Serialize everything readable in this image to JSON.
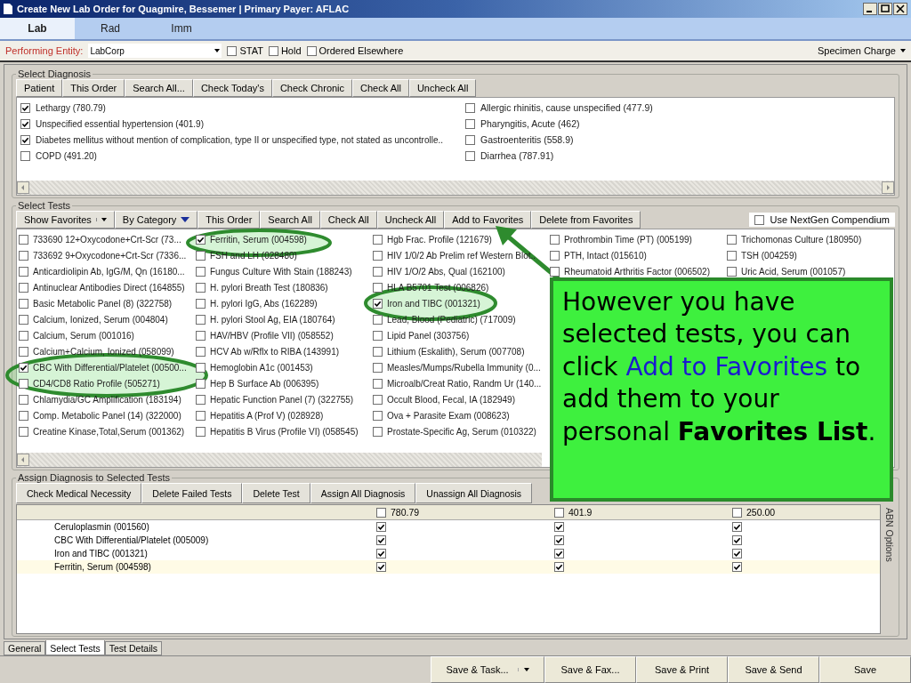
{
  "window": {
    "title": "Create New Lab Order for Quagmire, Bessemer | Primary Payer: AFLAC"
  },
  "tabs": [
    {
      "label": "Lab",
      "selected": true
    },
    {
      "label": "Rad",
      "selected": false
    },
    {
      "label": "Imm",
      "selected": false
    }
  ],
  "toolbar": {
    "entity_label": "Performing Entity:",
    "entity_value": "LabCorp",
    "options": [
      {
        "label": "STAT",
        "checked": false
      },
      {
        "label": "Hold",
        "checked": false
      },
      {
        "label": "Ordered Elsewhere",
        "checked": false
      }
    ],
    "specimen": "Specimen Charge"
  },
  "diagnosis": {
    "title": "Select Diagnosis",
    "buttons": [
      "Patient",
      "This Order",
      "Search All...",
      "Check Today's",
      "Check Chronic",
      "Check All",
      "Uncheck All"
    ],
    "columns": [
      [
        {
          "label": "Lethargy (780.79)",
          "checked": true
        },
        {
          "label": "Unspecified essential hypertension (401.9)",
          "checked": true
        },
        {
          "label": "Diabetes mellitus without mention of complication, type II or unspecified type, not stated as uncontrolle..",
          "checked": true
        },
        {
          "label": "COPD (491.20)",
          "checked": false
        }
      ],
      [
        {
          "label": "Allergic rhinitis, cause unspecified (477.9)",
          "checked": false
        },
        {
          "label": "Pharyngitis, Acute (462)",
          "checked": false
        },
        {
          "label": "Gastroenteritis (558.9)",
          "checked": false
        },
        {
          "label": "Diarrhea (787.91)",
          "checked": false
        }
      ]
    ]
  },
  "tests": {
    "title": "Select Tests",
    "buttons": [
      {
        "label": "Show Favorites",
        "kind": "split"
      },
      {
        "label": "By Category",
        "kind": "menu"
      },
      {
        "label": "This Order",
        "kind": "plain"
      },
      {
        "label": "Search All",
        "kind": "plain"
      },
      {
        "label": "Check All",
        "kind": "plain"
      },
      {
        "label": "Uncheck All",
        "kind": "plain"
      },
      {
        "label": "Add to Favorites",
        "kind": "plain"
      },
      {
        "label": "Delete from Favorites",
        "kind": "plain"
      }
    ],
    "compendium": {
      "label": "Use NextGen Compendium",
      "checked": false
    },
    "columns": [
      [
        {
          "label": "733690 12+Oxycodone+Crt-Scr (73...",
          "checked": false
        },
        {
          "label": "733692 9+Oxycodone+Crt-Scr (7336...",
          "checked": false
        },
        {
          "label": "Anticardiolipin Ab, IgG/M, Qn (16180...",
          "checked": false
        },
        {
          "label": "Antinuclear Antibodies Direct (164855)",
          "checked": false
        },
        {
          "label": "Basic Metabolic Panel (8) (322758)",
          "checked": false
        },
        {
          "label": "Calcium, Ionized, Serum (004804)",
          "checked": false
        },
        {
          "label": "Calcium, Serum (001016)",
          "checked": false
        },
        {
          "label": "Calcium+Calcium, Ionized (058099)",
          "checked": false
        },
        {
          "label": "CBC With Differential/Platelet (00500...",
          "checked": true
        },
        {
          "label": "CD4/CD8 Ratio Profile (505271)",
          "checked": false
        },
        {
          "label": "Chlamydia/GC Amplification (183194)",
          "checked": false
        },
        {
          "label": "Comp. Metabolic Panel (14) (322000)",
          "checked": false
        },
        {
          "label": "Creatine Kinase,Total,Serum (001362)",
          "checked": false
        }
      ],
      [
        {
          "label": "Ferritin, Serum (004598)",
          "checked": true
        },
        {
          "label": "FSH and LH (028480)",
          "checked": false
        },
        {
          "label": "Fungus Culture With Stain (188243)",
          "checked": false
        },
        {
          "label": "H. pylori Breath Test (180836)",
          "checked": false
        },
        {
          "label": "H. pylori IgG, Abs (162289)",
          "checked": false
        },
        {
          "label": "H. pylori Stool Ag, EIA (180764)",
          "checked": false
        },
        {
          "label": "HAV/HBV (Profile VII) (058552)",
          "checked": false
        },
        {
          "label": "HCV Ab w/Rflx to RIBA (143991)",
          "checked": false
        },
        {
          "label": "Hemoglobin A1c (001453)",
          "checked": false
        },
        {
          "label": "Hep B Surface Ab (006395)",
          "checked": false
        },
        {
          "label": "Hepatic Function Panel (7) (322755)",
          "checked": false
        },
        {
          "label": "Hepatitis A (Prof V) (028928)",
          "checked": false
        },
        {
          "label": "Hepatitis B Virus (Profile VI) (058545)",
          "checked": false
        }
      ],
      [
        {
          "label": "Hgb Frac. Profile (121679)",
          "checked": false
        },
        {
          "label": "HIV 1/0/2 Ab Prelim ref Western Blot..",
          "checked": false
        },
        {
          "label": "HIV 1/O/2 Abs, Qual (162100)",
          "checked": false
        },
        {
          "label": "HLA B5701 Test (006826)",
          "checked": false
        },
        {
          "label": "Iron and TIBC (001321)",
          "checked": true
        },
        {
          "label": "Lead, Blood (Pediatric) (717009)",
          "checked": false
        },
        {
          "label": "Lipid Panel (303756)",
          "checked": false
        },
        {
          "label": "Lithium (Eskalith), Serum (007708)",
          "checked": false
        },
        {
          "label": "Measles/Mumps/Rubella Immunity (0...",
          "checked": false
        },
        {
          "label": "Microalb/Creat Ratio, Randm Ur (140...",
          "checked": false
        },
        {
          "label": "Occult Blood, Fecal, IA (182949)",
          "checked": false
        },
        {
          "label": "Ova + Parasite Exam (008623)",
          "checked": false
        },
        {
          "label": "Prostate-Specific Ag, Serum (010322)",
          "checked": false
        }
      ],
      [
        {
          "label": "Prothrombin Time (PT) (005199)",
          "checked": false
        },
        {
          "label": "PTH, Intact (015610)",
          "checked": false
        },
        {
          "label": "Rheumatoid Arthritis Factor (006502)",
          "checked": false
        }
      ],
      [
        {
          "label": "Trichomonas Culture (180950)",
          "checked": false
        },
        {
          "label": "TSH (004259)",
          "checked": false
        },
        {
          "label": "Uric Acid, Serum (001057)",
          "checked": false
        }
      ]
    ]
  },
  "assign": {
    "title": "Assign Diagnosis to Selected Tests",
    "buttons": [
      "Check Medical Necessity",
      "Delete Failed Tests",
      "Delete Test",
      "Assign All Diagnosis",
      "Unassign All Diagnosis"
    ],
    "codes": [
      {
        "label": "780.79",
        "checked": false
      },
      {
        "label": "401.9",
        "checked": false
      },
      {
        "label": "250.00",
        "checked": false
      }
    ],
    "rows": [
      {
        "name": "Ceruloplasmin (001560)",
        "checks": [
          true,
          true,
          true
        ],
        "selected": false
      },
      {
        "name": "CBC With Differential/Platelet (005009)",
        "checks": [
          true,
          true,
          true
        ],
        "selected": false
      },
      {
        "name": "Iron and TIBC (001321)",
        "checks": [
          true,
          true,
          true
        ],
        "selected": false
      },
      {
        "name": "Ferritin, Serum (004598)",
        "checks": [
          true,
          true,
          true
        ],
        "selected": true
      }
    ],
    "side_label": "ABN Options"
  },
  "bottom_tabs": [
    {
      "label": "General",
      "selected": false
    },
    {
      "label": "Select Tests",
      "selected": true
    },
    {
      "label": "Test Details",
      "selected": false
    }
  ],
  "footer": [
    {
      "label": "Save & Task...",
      "kind": "split"
    },
    {
      "label": "Save & Fax...",
      "kind": "plain"
    },
    {
      "label": "Save & Print",
      "kind": "plain"
    },
    {
      "label": "Save & Send",
      "kind": "plain"
    },
    {
      "label": "Save",
      "kind": "plain"
    }
  ],
  "callout": {
    "parts": [
      {
        "text": "However you have selected tests, you can click ",
        "kind": "plain"
      },
      {
        "text": "Add to Favorites",
        "kind": "link"
      },
      {
        "text": " to add them to your personal ",
        "kind": "plain"
      },
      {
        "text": "Favorites List",
        "kind": "bold"
      },
      {
        "text": ".",
        "kind": "plain"
      }
    ]
  }
}
